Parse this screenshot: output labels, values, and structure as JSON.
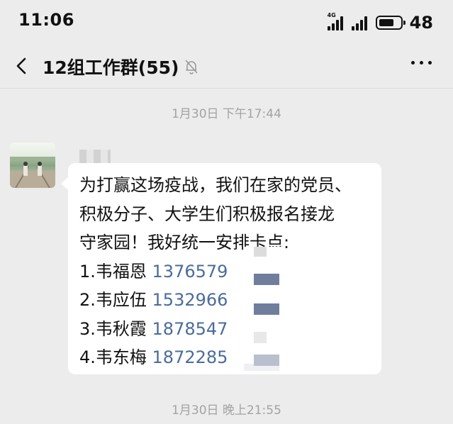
{
  "status_bar": {
    "time": "11:06",
    "network_label": "4G",
    "battery_level": "48"
  },
  "header": {
    "title": "12组工作群(55)"
  },
  "messages": [
    {
      "timestamp": "1月30日 下午17:44",
      "lines": [
        "为打赢这场疫战，我们在家的党员、",
        "积极分子、大学生们积极报名接龙",
        "守家园！我好统一安排卡点:"
      ],
      "entries": [
        {
          "prefix": "1.韦福恩 ",
          "phone": "1376579"
        },
        {
          "prefix": "2.韦应伍 ",
          "phone": "1532966"
        },
        {
          "prefix": "3.韦秋霞 ",
          "phone": "1878547"
        },
        {
          "prefix": "4.韦东梅 ",
          "phone": "1872285"
        }
      ]
    }
  ],
  "next_timestamp": "1月30日 晚上21:55",
  "colors": {
    "background": "#ececec",
    "bubble": "#ffffff",
    "phone_link": "#4a6c9b",
    "timestamp": "#a3a3a3"
  }
}
